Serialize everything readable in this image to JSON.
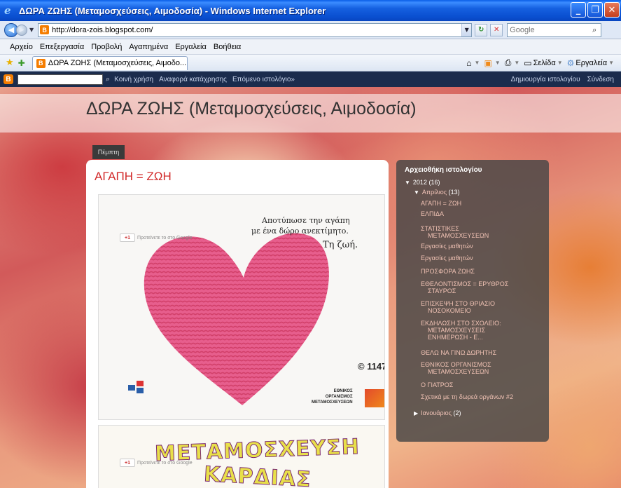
{
  "window": {
    "title": "ΔΩΡΑ ΖΩΗΣ (Μεταμοσχεύσεις, Αιμοδοσία) - Windows Internet Explorer"
  },
  "address": {
    "url": "http://dora-zois.blogspot.com/",
    "search_placeholder": "Google"
  },
  "menu": {
    "items": [
      "Αρχείο",
      "Επεξεργασία",
      "Προβολή",
      "Αγαπημένα",
      "Εργαλεία",
      "Βοήθεια"
    ]
  },
  "tabbar": {
    "tab_title": "ΔΩΡΑ ΖΩΗΣ (Μεταμοσχεύσεις, Αιμοδο...",
    "page_label": "Σελίδα",
    "tools_label": "Εργαλεία"
  },
  "blogger_bar": {
    "links": [
      "Κοινή χρήση",
      "Αναφορά κατάχρησης",
      "Επόμενο ιστολόγιο»"
    ],
    "right_links": [
      "Δημιουργία ιστολογίου",
      "Σύνδεση"
    ]
  },
  "blog": {
    "title": "ΔΩΡΑ ΖΩΗΣ (Μεταμοσχεύσεις, Αιμοδοσία)",
    "page_tab": "Πέμπτη",
    "post_title": "ΑΓΑΠΗ = ΖΩΗ",
    "image1": {
      "line1": "Αποτύπωσε την αγάπη",
      "line2": "με ένα δώρο ανεκτίμητο.",
      "line3": "Τη ζωή.",
      "phone": "© 1147",
      "org": [
        "ΕΘΝΙΚΟΣ",
        "ΟΡΓΑΝΙΣΜΟΣ",
        "ΜΕΤΑΜΟΣΧΕΥΣΕΩΝ"
      ],
      "gplus": "+1",
      "gplus_label": "Προτείνετε το στο Google"
    },
    "image2": {
      "line1": "ΜΕΤΑΜΟΣΧΕΥΣΗ",
      "line2": "ΚΑΡΔΙΑΣ",
      "gplus": "+1",
      "gplus_label": "Προτείνετε το στο Google"
    }
  },
  "archive": {
    "title": "Αρχειοθήκη ιστολογίου",
    "year": "2012",
    "year_count": "(16)",
    "month": "Απρίλιος",
    "month_count": "(13)",
    "posts": [
      [
        "ΑΓΑΠΗ = ΖΩΗ"
      ],
      [
        "ΕΛΠΙΔΑ"
      ],
      [
        "ΣΤΑΤΙΣΤΙΚΕΣ",
        "ΜΕΤΑΜΟΣΧΕΥΣΕΩΝ"
      ],
      [
        "Εργασίες μαθητών"
      ],
      [
        "Εργασίες μαθητών"
      ],
      [
        "ΠΡΟΣΦΟΡΑ ΖΩΗΣ"
      ],
      [
        "ΕΘΕΛΟΝΤΙΣΜΟΣ = ΕΡΥΘΡΟΣ",
        "ΣΤΑΥΡΟΣ"
      ],
      [
        "ΕΠΙΣΚΕΨΗ ΣΤΟ ΘΡΙΑΣΙΟ",
        "ΝΟΣΟΚΟΜΕΙΟ"
      ],
      [
        "ΕΚΔΗΛΩΣΗ ΣΤΟ ΣΧΟΛΕΙΟ:",
        "ΜΕΤΑΜΟΣΧΕΥΣΕΙΣ",
        "ΕΝΗΜΕΡΩΣΗ - Ε..."
      ],
      [
        "ΘΕΛΩ ΝΑ ΓΙΝΩ ΔΩΡΗΤΗΣ"
      ],
      [
        "ΕΘΝΙΚΟΣ ΟΡΓΑΝΙΣΜΟΣ",
        "ΜΕΤΑΜΟΣΧΕΥΣΕΩΝ"
      ],
      [
        "Ο ΓΙΑΤΡΟΣ"
      ],
      [
        "Σχετικά με τη δωρεά οργάνων #2"
      ]
    ],
    "month2": "Ιανουάριος",
    "month2_count": "(2)"
  },
  "colors": {
    "post_title": "#d22a2a",
    "blogger_bar": "#1b2c4d",
    "titlebar": "#0a4fd0"
  }
}
